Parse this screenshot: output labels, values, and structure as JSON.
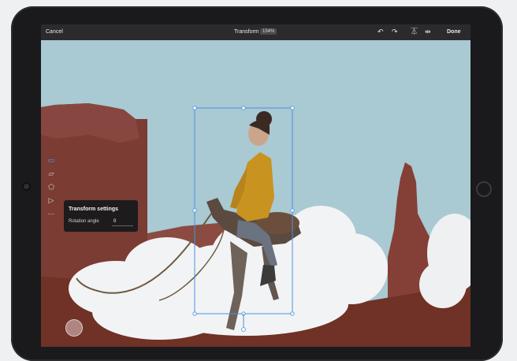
{
  "topbar": {
    "cancel_label": "Cancel",
    "title": "Transform",
    "zoom": "154%",
    "done_label": "Done",
    "icons": [
      "undo-icon",
      "redo-icon",
      "flip-vertical-icon",
      "flip-horizontal-icon"
    ]
  },
  "tools": [
    "rectangle-select-icon",
    "distort-icon",
    "perspective-icon",
    "triangle-warp-icon",
    "more-icon"
  ],
  "popover": {
    "title": "Transform settings",
    "label": "Rotation angle",
    "value": "0"
  },
  "colors": {
    "sky": "#a9c9d3",
    "rock": "#7a3b33",
    "selection": "#4a90e2",
    "toolbar": "#2b2b2d"
  }
}
